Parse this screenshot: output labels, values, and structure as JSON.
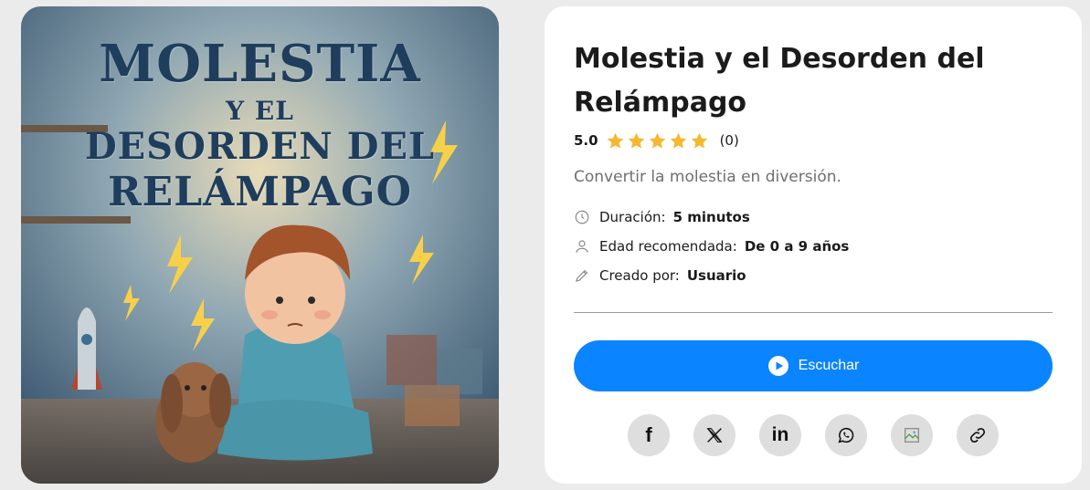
{
  "cover": {
    "title_line1": "MOLESTIA",
    "title_line2": "Y EL",
    "title_line3": "DESORDEN DEL",
    "title_line4": "RELÁMPAGO"
  },
  "story": {
    "title": "Molestia y el Desorden del Relámpago",
    "rating": "5.0",
    "stars": 5,
    "rating_count": "(0)",
    "subtitle": "Convertir la molestia en diversión.",
    "duration_label": "Duración:",
    "duration_value": "5 minutos",
    "age_label": "Edad recomendada:",
    "age_value": "De 0 a 9 años",
    "creator_label": "Creado por:",
    "creator_value": "Usuario"
  },
  "actions": {
    "listen_label": "Escuchar",
    "share_icons": [
      "facebook-icon",
      "x-icon",
      "linkedin-icon",
      "whatsapp-icon",
      "broken-image-icon",
      "link-icon"
    ]
  },
  "colors": {
    "accent": "#0a84ff",
    "star": "#f5b82e",
    "share_bg": "#dedede"
  }
}
